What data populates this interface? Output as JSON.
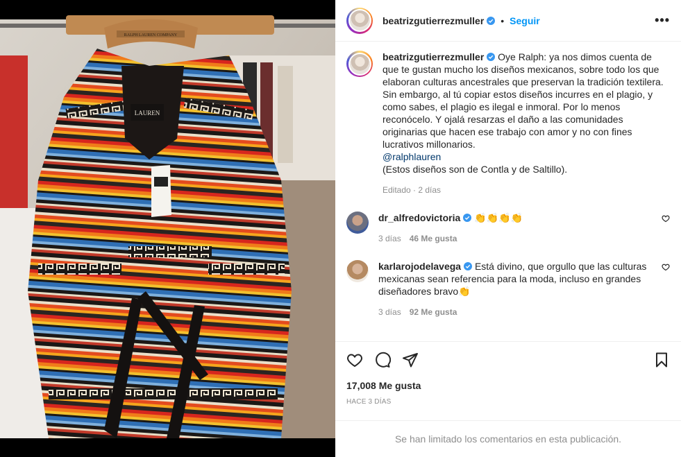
{
  "post": {
    "author": "beatrizgutierrezmuller",
    "follow_label": "Seguir",
    "more_label": "•••",
    "caption_lines": [
      "Oye Ralph: ya nos dimos cuenta de que te gustan mucho los diseños mexicanos, sobre todo los que elaboran culturas ancestrales que preservan la tradición textilera.",
      "Sin embargo, al tú copiar estos diseños incurres en el plagio, y como sabes, el plagio es ilegal e inmoral. Por lo menos reconócelo. Y ojalá resarzas el daño a las comunidades originarias que hacen ese trabajo con amor y no con fines lucrativos millonarios."
    ],
    "caption_mention": "@ralphlauren",
    "caption_note": "(Estos diseños son de Contla y de Saltillo).",
    "caption_meta": "Editado · 2 días",
    "likes": "17,008 Me gusta",
    "time_ago": "Hace 3 días",
    "comments_limited": "Se han limitado los comentarios en esta publicación."
  },
  "comments": [
    {
      "user": "dr_alfredovictoria",
      "text": "👏👏👏👏",
      "age": "3 días",
      "likes": "46 Me gusta"
    },
    {
      "user": "karlarojodelavega",
      "text": "Está divino, que orgullo que las culturas mexicanas sean referencia para la moda, incluso en grandes diseñadores bravo👏",
      "age": "3 días",
      "likes": "92 Me gusta"
    }
  ],
  "image": {
    "tag_text": "LAUREN",
    "hanger_text": "RALPH LAUREN COMPANY"
  },
  "colors": {
    "accent": "#0095f6",
    "verified": "#3897f0",
    "muted": "#8e8e8e",
    "mention": "#00376b"
  },
  "icons": [
    "verified-icon",
    "more-icon",
    "heart-icon",
    "comment-icon",
    "share-icon",
    "bookmark-icon"
  ]
}
